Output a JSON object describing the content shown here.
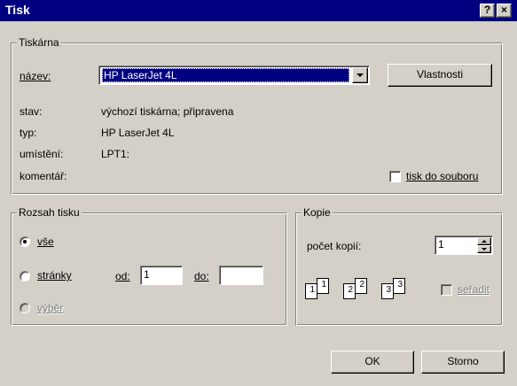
{
  "window": {
    "title": "Tisk",
    "help_glyph": "?",
    "close_glyph": "×"
  },
  "printer": {
    "group_title": "Tiskárna",
    "name_label": "název:",
    "name_value": "HP LaserJet 4L",
    "properties_button": "Vlastnosti",
    "status_label": "stav:",
    "status_value": "výchozí tiskárna; připravena",
    "type_label": "typ:",
    "type_value": "HP LaserJet 4L",
    "location_label": "umístění:",
    "location_value": "LPT1:",
    "comment_label": "komentář:",
    "print_to_file_label": "tisk do souboru",
    "print_to_file_checked": false
  },
  "range": {
    "group_title": "Rozsah tisku",
    "all_label": "vše",
    "pages_label": "stránky",
    "from_label": "od:",
    "from_value": "1",
    "to_label": "do:",
    "to_value": "",
    "selection_label": "výběr",
    "selected": "all"
  },
  "copies": {
    "group_title": "Kopie",
    "count_label": "počet kopií:",
    "count_value": "1",
    "collate_label": "seřadit",
    "collate_checked": false,
    "page_numbers": [
      "1",
      "1",
      "2",
      "2",
      "3",
      "3"
    ]
  },
  "buttons": {
    "ok": "OK",
    "cancel": "Storno"
  }
}
